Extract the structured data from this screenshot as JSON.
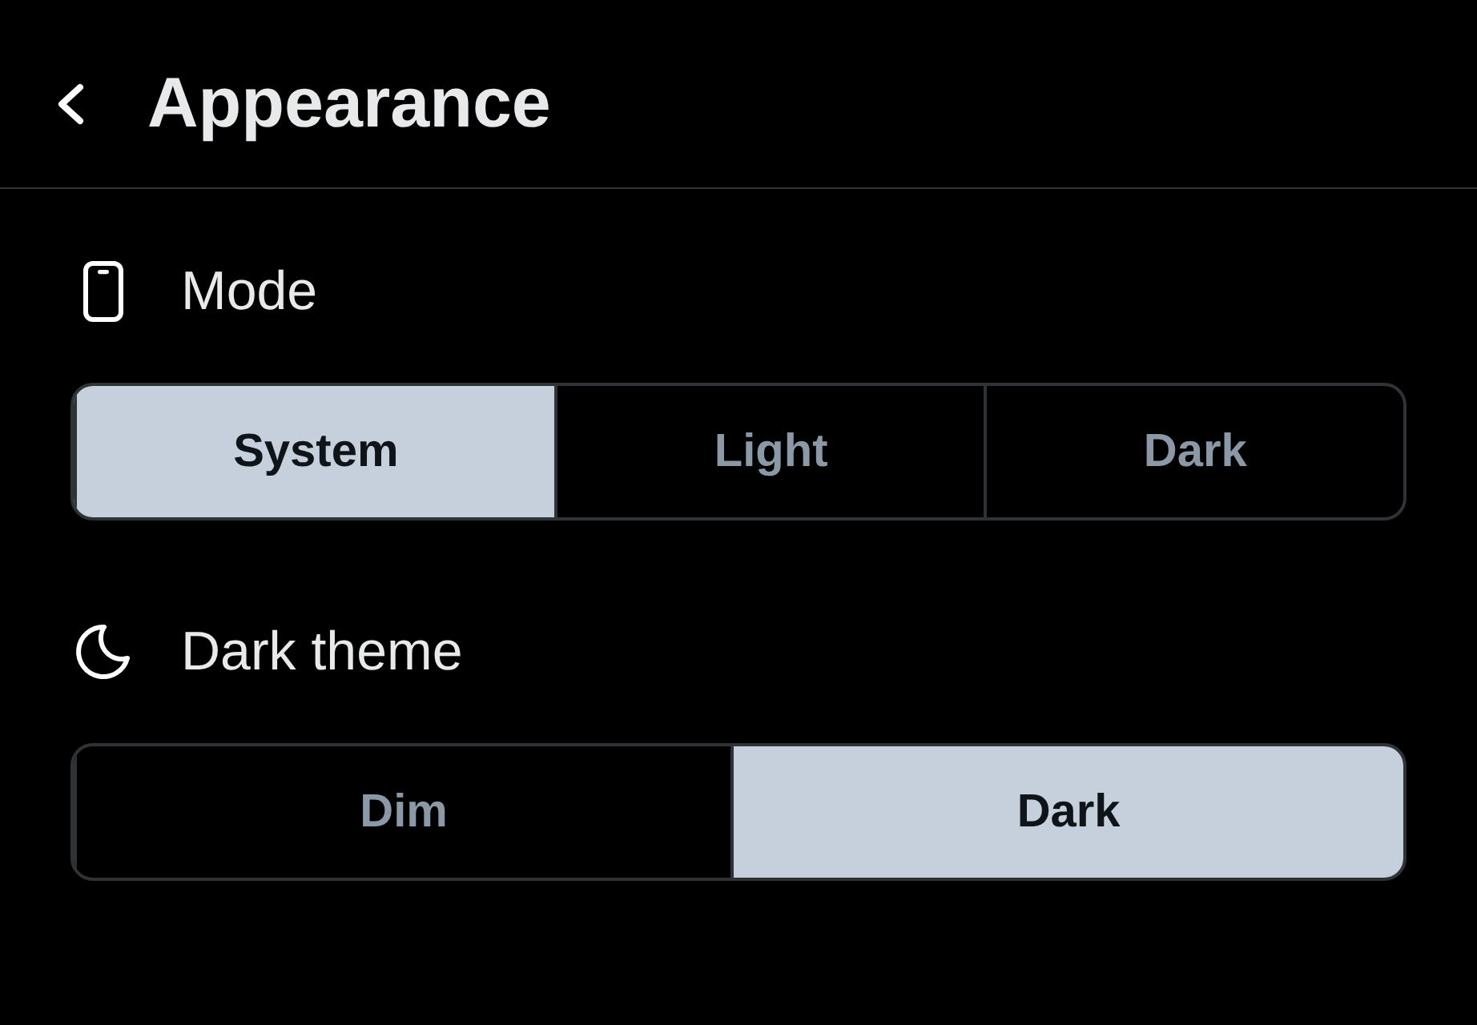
{
  "header": {
    "title": "Appearance"
  },
  "sections": [
    {
      "kind": "mode",
      "label": "Mode",
      "options": [
        {
          "label": "System",
          "selected": true
        },
        {
          "label": "Light",
          "selected": false
        },
        {
          "label": "Dark",
          "selected": false
        }
      ]
    },
    {
      "kind": "dark_theme",
      "label": "Dark theme",
      "options": [
        {
          "label": "Dim",
          "selected": false
        },
        {
          "label": "Dark",
          "selected": true
        }
      ]
    }
  ]
}
